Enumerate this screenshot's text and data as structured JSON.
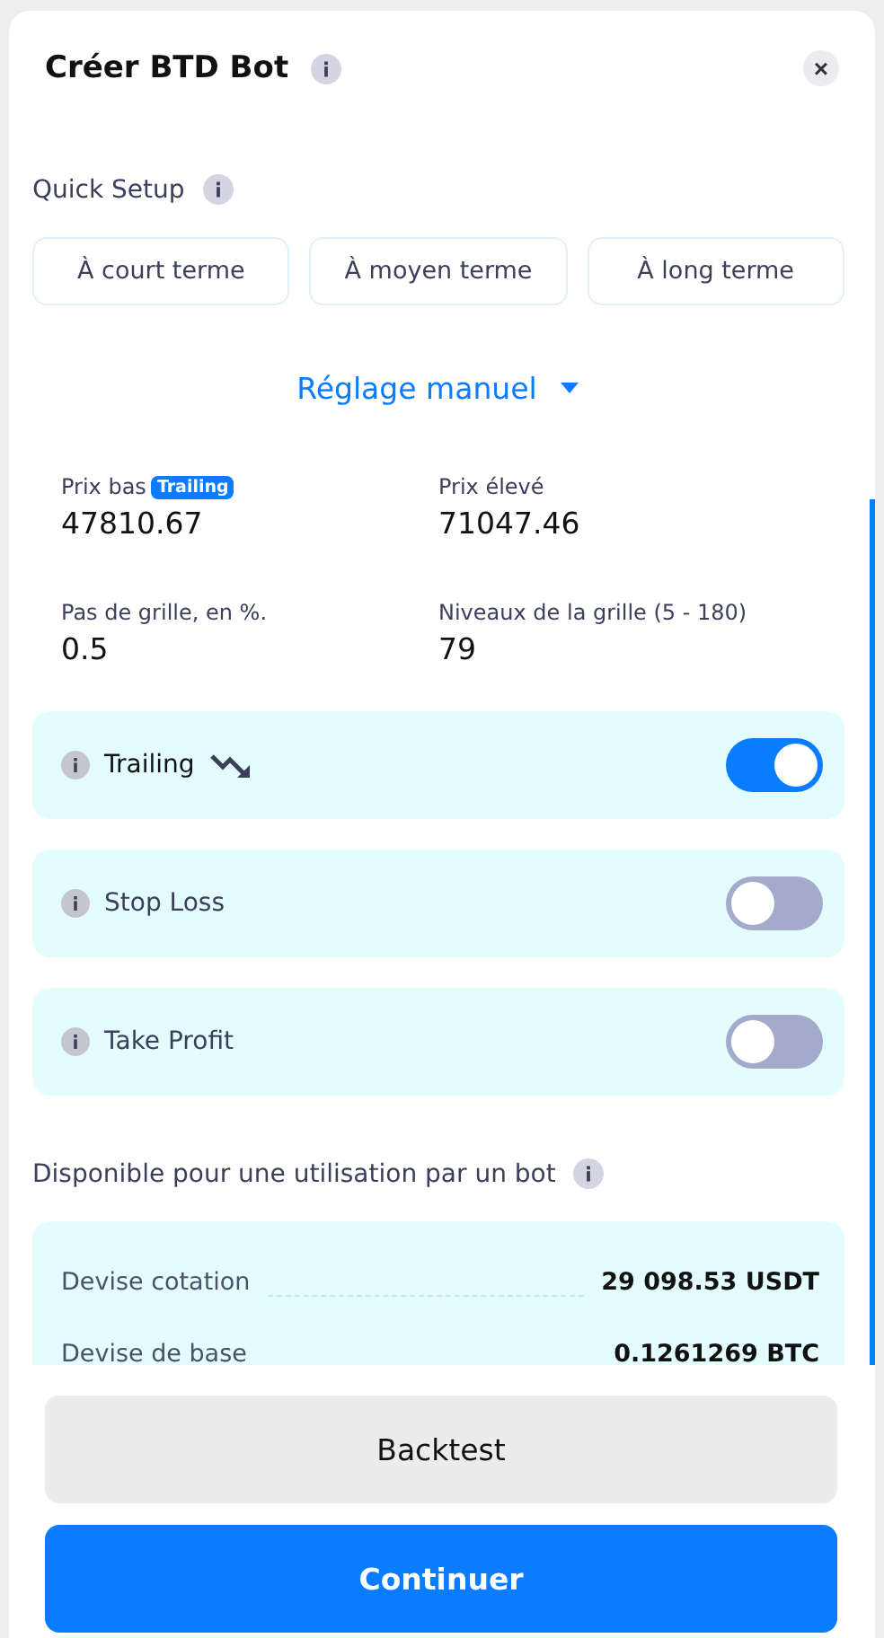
{
  "dialog": {
    "title": "Créer BTD Bot",
    "close": "×"
  },
  "quick_setup": {
    "label": "Quick Setup",
    "options": [
      {
        "label": "À court terme",
        "selected": false
      },
      {
        "label": "À moyen terme",
        "selected": false
      },
      {
        "label": "À long terme",
        "selected": false
      }
    ]
  },
  "manual": {
    "label": "Réglage manuel",
    "expanded": true
  },
  "fields": [
    {
      "label": "Prix bas",
      "badge": "Trailing",
      "value": "47810.67"
    },
    {
      "label": "Prix élevé",
      "value": "71047.46"
    },
    {
      "label": "Pas de grille, en %.",
      "value": "0.5"
    },
    {
      "label": "Niveaux de la grille (5 - 180)",
      "value": "79"
    }
  ],
  "toggles": [
    {
      "label": "Trailing",
      "kind": "trend",
      "on": true
    },
    {
      "label": "Stop Loss",
      "kind": "plain",
      "on": false
    },
    {
      "label": "Take Profit",
      "kind": "plain",
      "on": false
    }
  ],
  "available": {
    "label": "Disponible pour une utilisation par un bot",
    "rows": [
      {
        "label": "Devise cotation",
        "value": "29 098.53 USDT"
      },
      {
        "label": "Devise de base",
        "value": "0.1261269 BTC"
      }
    ]
  },
  "buttons": [
    {
      "label": "Backtest",
      "kind": "secondary"
    },
    {
      "label": "Continuer",
      "kind": "primary"
    }
  ]
}
